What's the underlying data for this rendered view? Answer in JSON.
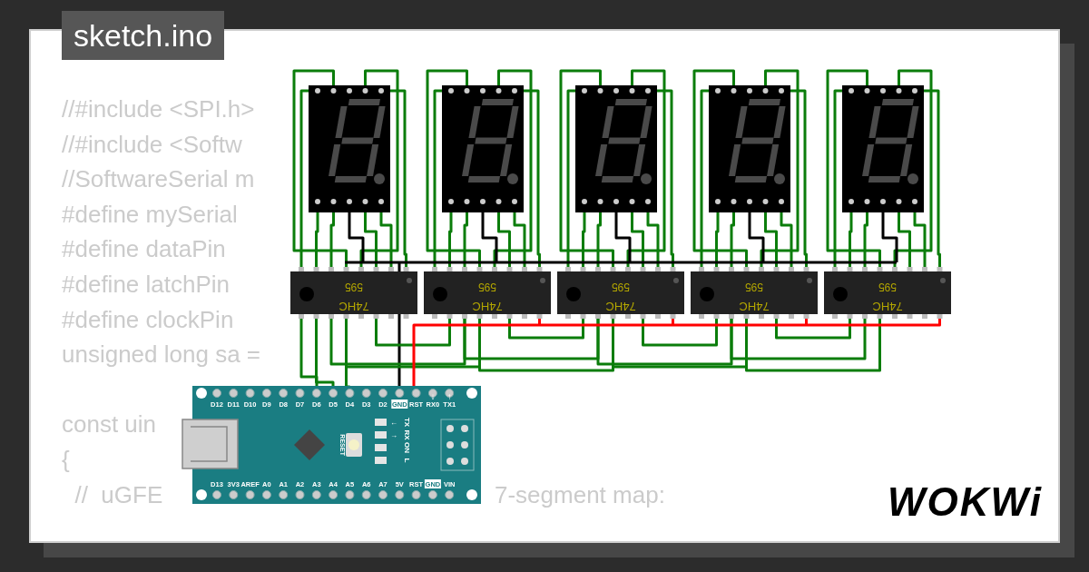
{
  "tab": {
    "title": "sketch.ino"
  },
  "code_blocks": [
    {
      "lines": [
        {
          "text": "//#include <SPI.h>"
        },
        {
          "text": "//#include <Softw"
        },
        {
          "text": "//SoftwareSerial m"
        },
        {
          "text": "#define mySerial"
        },
        {
          "text": "#define dataPin"
        },
        {
          "text": "#define latchPin"
        },
        {
          "text": "#define clockPin"
        },
        {
          "text": "unsigned long sa ="
        }
      ]
    },
    {
      "lines": [
        {
          "text": "const uin"
        },
        {
          "text": "{"
        },
        {
          "text": "  //  uGFE",
          "tail": "7-segment map:"
        }
      ]
    }
  ],
  "displays": [
    {
      "lit": false
    },
    {
      "lit": false
    },
    {
      "lit": false
    },
    {
      "lit": false
    },
    {
      "lit": false
    }
  ],
  "chips": [
    {
      "line_1": "595",
      "line_2": "74HC"
    },
    {
      "line_1": "595",
      "line_2": "74HC"
    },
    {
      "line_1": "595",
      "line_2": "74HC"
    },
    {
      "line_1": "595",
      "line_2": "74HC"
    },
    {
      "line_1": "595",
      "line_2": "74HC"
    }
  ],
  "arduino": {
    "top_pins": [
      {
        "label": "D12",
        "highlighted": false
      },
      {
        "label": "D11",
        "highlighted": false
      },
      {
        "label": "D10",
        "highlighted": false
      },
      {
        "label": "D9",
        "highlighted": false
      },
      {
        "label": "D8",
        "highlighted": false
      },
      {
        "label": "D7",
        "highlighted": false
      },
      {
        "label": "D6",
        "highlighted": false
      },
      {
        "label": "D5",
        "highlighted": false
      },
      {
        "label": "D4",
        "highlighted": false
      },
      {
        "label": "D3",
        "highlighted": false
      },
      {
        "label": "D2",
        "highlighted": false
      },
      {
        "label": "GND",
        "highlighted": true
      },
      {
        "label": "RST",
        "highlighted": false
      },
      {
        "label": "RX0",
        "highlighted": false,
        "arrow": "↓"
      },
      {
        "label": "TX1",
        "highlighted": false,
        "arrow": "↑"
      }
    ],
    "bottom_pins": [
      {
        "label": "D13",
        "highlighted": false
      },
      {
        "label": "3V3",
        "highlighted": false
      },
      {
        "label": "AREF",
        "highlighted": false
      },
      {
        "label": "A0",
        "highlighted": false
      },
      {
        "label": "A1",
        "highlighted": false
      },
      {
        "label": "A2",
        "highlighted": false
      },
      {
        "label": "A3",
        "highlighted": false
      },
      {
        "label": "A4",
        "highlighted": false
      },
      {
        "label": "A5",
        "highlighted": false
      },
      {
        "label": "A6",
        "highlighted": false
      },
      {
        "label": "A7",
        "highlighted": false
      },
      {
        "label": "5V",
        "highlighted": false
      },
      {
        "label": "RST",
        "highlighted": false
      },
      {
        "label": "GND",
        "highlighted": true
      },
      {
        "label": "VIN",
        "highlighted": false
      }
    ],
    "reset_label": "RESET",
    "leds": [
      {
        "arrow": "←",
        "label": "TX"
      },
      {
        "arrow": "→",
        "label": "RX"
      },
      {
        "label": "ON"
      },
      {
        "label": "L"
      }
    ]
  },
  "logo": "WOKWi"
}
